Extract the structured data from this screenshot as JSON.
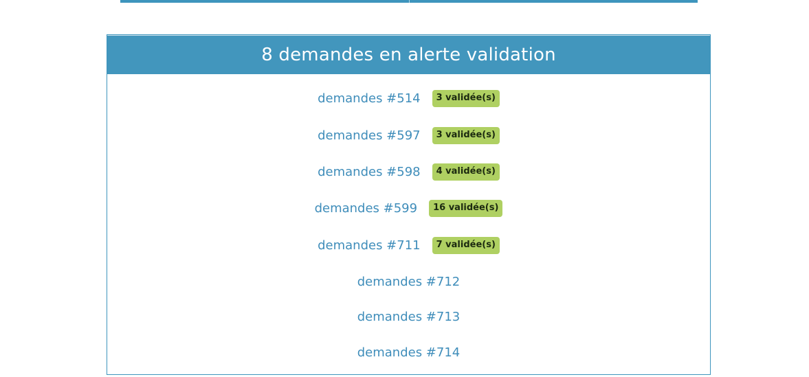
{
  "panel": {
    "title": "8 demandes en alerte validation",
    "colors": {
      "header_bg": "#4296bd",
      "link": "#3f8dba",
      "badge_bg": "#afd062"
    }
  },
  "requests": [
    {
      "label": "demandes #514",
      "badge": "3 validée(s)"
    },
    {
      "label": "demandes #597",
      "badge": "3 validée(s)"
    },
    {
      "label": "demandes #598",
      "badge": "4 validée(s)"
    },
    {
      "label": "demandes #599",
      "badge": "16 validée(s)"
    },
    {
      "label": "demandes #711",
      "badge": "7 validée(s)"
    },
    {
      "label": "demandes #712",
      "badge": ""
    },
    {
      "label": "demandes #713",
      "badge": ""
    },
    {
      "label": "demandes #714",
      "badge": ""
    }
  ]
}
